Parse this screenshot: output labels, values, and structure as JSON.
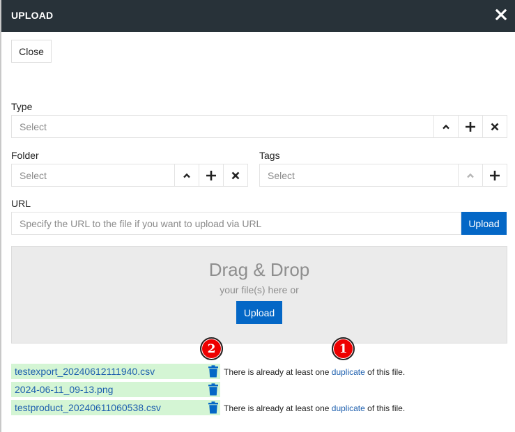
{
  "dialog": {
    "title": "UPLOAD",
    "close_button": "Close",
    "close_icon": "close-icon"
  },
  "fields": {
    "type": {
      "label": "Type",
      "placeholder": "Select",
      "icons": [
        "chevron-up-icon",
        "plus-icon",
        "clear-icon"
      ]
    },
    "folder": {
      "label": "Folder",
      "placeholder": "Select",
      "icons": [
        "chevron-up-icon",
        "plus-icon",
        "clear-icon"
      ]
    },
    "tags": {
      "label": "Tags",
      "placeholder": "Select",
      "icons": [
        "chevron-up-icon",
        "plus-icon"
      ]
    },
    "url": {
      "label": "URL",
      "placeholder": "Specify the URL to the file if you want to upload via URL",
      "value": "",
      "button": "Upload"
    }
  },
  "dropzone": {
    "title": "Drag & Drop",
    "subtitle": "your file(s) here or",
    "button": "Upload"
  },
  "files": [
    {
      "name": "testexport_20240612111940.csv",
      "duplicate": true
    },
    {
      "name": "2024-06-11_09-13.png",
      "duplicate": false
    },
    {
      "name": "testproduct_20240611060538.csv",
      "duplicate": true
    }
  ],
  "duplicate_message": {
    "prefix": "There is already at least one ",
    "link": "duplicate",
    "suffix": " of this file."
  },
  "annotations": [
    {
      "number": "1"
    },
    {
      "number": "2"
    }
  ],
  "colors": {
    "header_bg": "#283239",
    "primary": "#0467c6",
    "file_row_bg": "#d4f5d4",
    "link": "#1d5fae",
    "badge": "#ee0000"
  }
}
